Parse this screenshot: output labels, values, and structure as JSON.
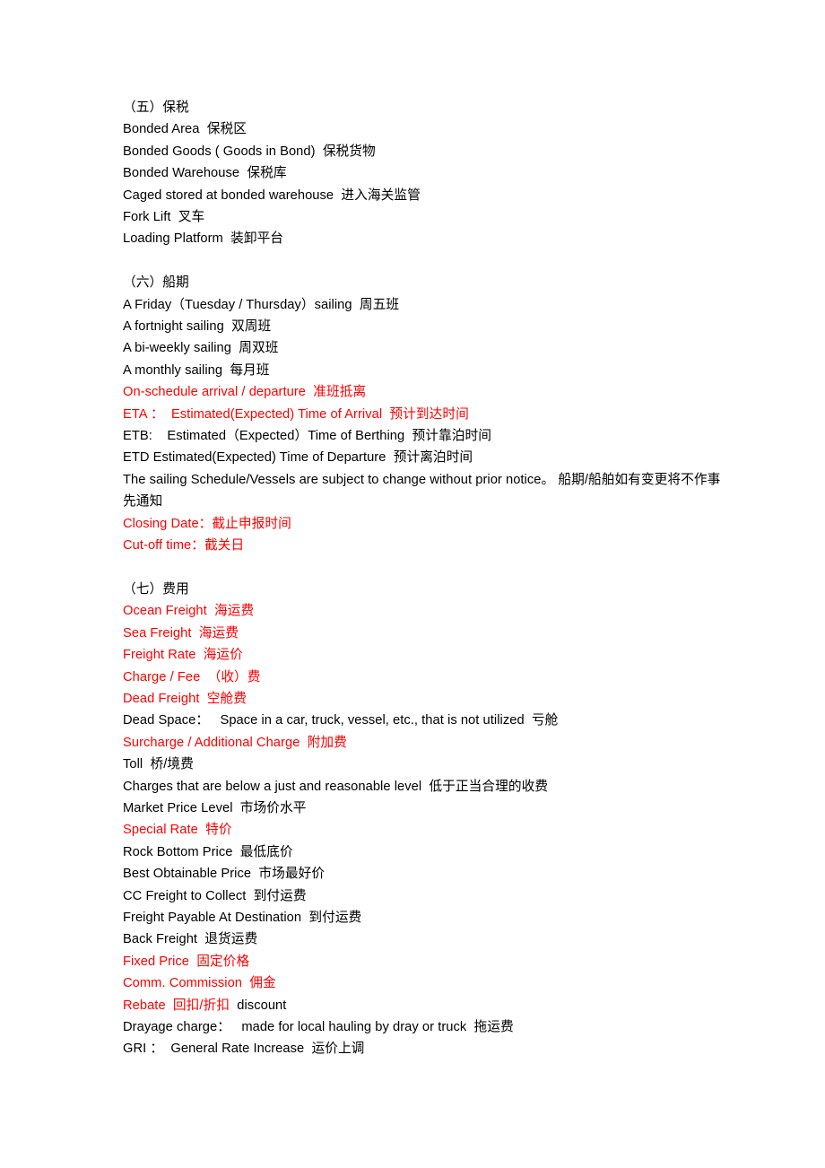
{
  "document": {
    "text_color_default": "#000000",
    "accent_color": "#FF0000",
    "background": "#ffffff",
    "sections": [
      {
        "id": "section-bonded",
        "heading": "（五）保税",
        "lines": [
          {
            "text": "Bonded Area  保税区",
            "color": "black"
          },
          {
            "text": "Bonded Goods ( Goods in Bond)  保税货物",
            "color": "black"
          },
          {
            "text": "Bonded Warehouse  保税库",
            "color": "black"
          },
          {
            "text": "Caged stored at bonded warehouse  进入海关监管",
            "color": "black"
          },
          {
            "text": "Fork Lift  叉车",
            "color": "black"
          },
          {
            "text": "Loading Platform  装卸平台",
            "color": "black"
          }
        ]
      },
      {
        "id": "section-sailing-schedule",
        "heading": "（六）船期",
        "lines": [
          {
            "text": "A Friday（Tuesday / Thursday）sailing  周五班",
            "color": "black"
          },
          {
            "text": "A fortnight sailing  双周班",
            "color": "black"
          },
          {
            "text": "A bi-weekly sailing  周双班",
            "color": "black"
          },
          {
            "text": "A monthly sailing  每月班",
            "color": "black"
          },
          {
            "text": "On-schedule arrival / departure  准班抵离",
            "color": "red"
          },
          {
            "text": "ETA ：  Estimated(Expected) Time of Arrival  预计到达时间",
            "color": "red"
          },
          {
            "text": "ETB:    Estimated（Expected）Time of Berthing  预计靠泊时间",
            "color": "black"
          },
          {
            "text": "ETD Estimated(Expected) Time of Departure  预计离泊时间",
            "color": "black"
          },
          {
            "text": "The sailing Schedule/Vessels are subject to change without prior notice。  船期/船舶如有变更将不作事先通知",
            "color": "black",
            "wrap": true
          },
          {
            "text": "Closing Date：截止申报时间",
            "color": "red"
          },
          {
            "text": "Cut-off time：截关日",
            "color": "red"
          }
        ]
      },
      {
        "id": "section-charges",
        "heading": "（七）费用",
        "lines": [
          {
            "text": "Ocean Freight  海运费",
            "color": "red"
          },
          {
            "text": "Sea Freight  海运费",
            "color": "red"
          },
          {
            "text": "Freight Rate  海运价",
            "color": "red"
          },
          {
            "text": "Charge / Fee  （收）费",
            "color": "red"
          },
          {
            "text": "Dead Freight  空舱费",
            "color": "red"
          },
          {
            "text": "Dead Space：   Space in a car, truck, vessel, etc., that is not utilized  亏舱",
            "color": "black"
          },
          {
            "text": "Surcharge / Additional Charge  附加费",
            "color": "red"
          },
          {
            "text": "Toll  桥/境费",
            "color": "black"
          },
          {
            "text": "Charges that are below a just and reasonable level  低于正当合理的收费",
            "color": "black"
          },
          {
            "text": "Market Price Level  市场价水平",
            "color": "black"
          },
          {
            "text": "Special Rate  特价",
            "color": "red"
          },
          {
            "text": "Rock Bottom Price  最低底价",
            "color": "black"
          },
          {
            "text": "Best Obtainable Price  市场最好价",
            "color": "black"
          },
          {
            "text": "CC Freight to Collect  到付运费",
            "color": "black"
          },
          {
            "text": "Freight Payable At Destination  到付运费",
            "color": "black"
          },
          {
            "text": "Back Freight  退货运费",
            "color": "black"
          },
          {
            "text": "Fixed Price  固定价格",
            "color": "red"
          },
          {
            "text": "Comm. Commission  佣金",
            "color": "red"
          },
          {
            "text": "Rebate  回扣/折扣",
            "color": "red",
            "trailing_black": "  discount"
          },
          {
            "text": "Drayage charge：   made for local hauling by dray or truck  拖运费",
            "color": "black"
          },
          {
            "text": "GRI ：  General Rate Increase  运价上调",
            "color": "black"
          }
        ]
      }
    ]
  }
}
